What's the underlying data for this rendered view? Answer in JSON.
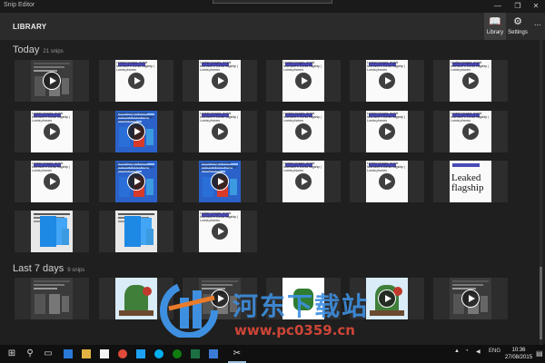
{
  "window": {
    "title": "Snip Editor",
    "minimize": "—",
    "restore": "❐",
    "close": "✕"
  },
  "header": {
    "title": "LIBRARY",
    "library_label": "Library",
    "settings_label": "Settings",
    "more": "..."
  },
  "sections": [
    {
      "name": "Today",
      "count": "21 snips"
    },
    {
      "name": "Last 7 days",
      "count": "9 snips"
    }
  ],
  "tile_caption": "Leaked images reveal Microsoft's Lumia flagship | Lumia phones",
  "tile_big_text": "Leaked flagship",
  "watermark": {
    "text": "河东下载站",
    "url": "www.pc0359.cn"
  },
  "taskbar": {
    "lang": "ENG",
    "time": "10:36",
    "date": "27/08/2015"
  },
  "colors": {
    "accent": "#3e8fe0",
    "background": "#1f1f1f",
    "header": "#2b2b2b"
  }
}
